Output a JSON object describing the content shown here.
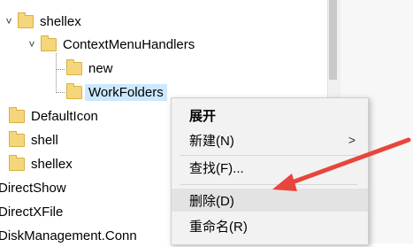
{
  "tree": {
    "rows": [
      {
        "label": "shellex"
      },
      {
        "label": "ContextMenuHandlers"
      },
      {
        "label": "new"
      },
      {
        "label": "WorkFolders"
      },
      {
        "label": "DefaultIcon"
      },
      {
        "label": "shell"
      },
      {
        "label": "shellex"
      },
      {
        "label": "DirectShow"
      },
      {
        "label": "DirectXFile"
      },
      {
        "label": "DiskManagement.Conn"
      }
    ]
  },
  "context_menu": {
    "items": [
      {
        "label": "展开"
      },
      {
        "label": "新建(N)"
      },
      {
        "label": "查找(F)..."
      },
      {
        "label": "删除(D)"
      },
      {
        "label": "重命名(R)"
      }
    ],
    "submenu_arrow": ">"
  },
  "colors": {
    "annotation_arrow": "#e8453c",
    "folder": "#f5d67b",
    "selection": "#cce8ff",
    "menu_background": "#f2f2f2"
  }
}
